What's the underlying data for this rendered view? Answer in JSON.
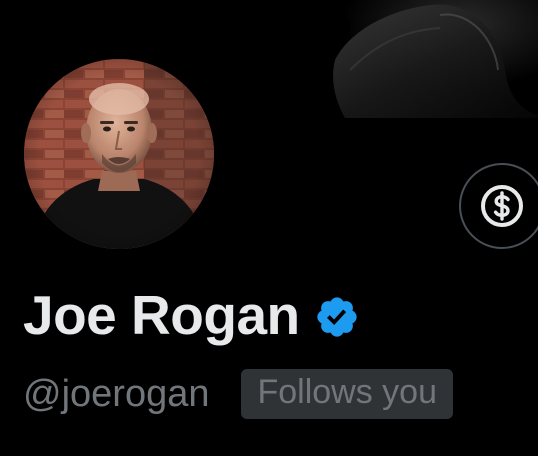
{
  "profile": {
    "display_name": "Joe Rogan",
    "handle": "@joerogan",
    "follows_you_label": "Follows you",
    "verified": true
  },
  "icons": {
    "verified": "verified-badge-icon",
    "tip": "dollar-icon"
  },
  "colors": {
    "background": "#000000",
    "name_text": "#e7e9ea",
    "secondary_text": "#71767b",
    "badge_background": "#2f3336",
    "verified_blue": "#1d9bf0",
    "button_border": "#4a4f55"
  }
}
